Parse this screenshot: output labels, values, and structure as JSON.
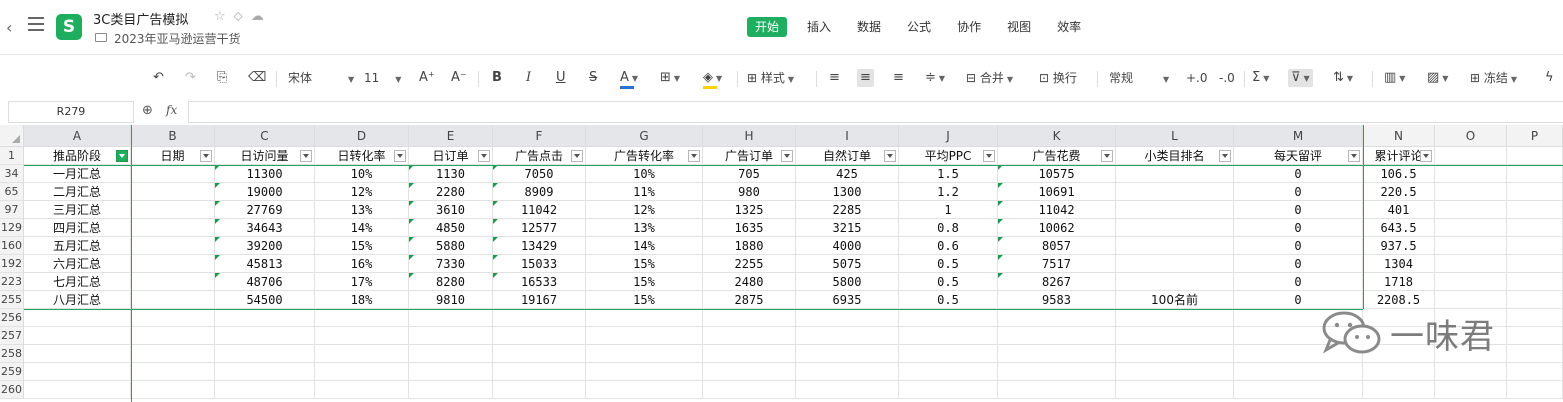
{
  "app": {
    "logo_letter": "S",
    "doc_title": "3C类目广告模拟",
    "doc_path": "2023年亚马逊运营干货"
  },
  "menu_tabs": [
    "开始",
    "插入",
    "数据",
    "公式",
    "协作",
    "视图",
    "效率"
  ],
  "active_tab": "开始",
  "toolbar": {
    "font_name": "宋体",
    "font_size": "11",
    "style_label": "样式",
    "merge_label": "合并",
    "wrap_label": "换行",
    "number_format": "常规",
    "freeze_label": "冻结"
  },
  "formula_bar": {
    "name_box": "R279",
    "fx": "fx",
    "formula": ""
  },
  "columns": [
    "A",
    "B",
    "C",
    "D",
    "E",
    "F",
    "G",
    "H",
    "I",
    "J",
    "K",
    "L",
    "M",
    "N",
    "O",
    "P"
  ],
  "selected_columns": [
    "A",
    "B",
    "C",
    "D",
    "E",
    "F",
    "G",
    "H",
    "I",
    "J",
    "K",
    "L",
    "M"
  ],
  "header_row": {
    "row_label": "1",
    "cells": [
      "推品阶段",
      "日期",
      "日访问量",
      "日转化率",
      "日订单",
      "广告点击",
      "广告转化率",
      "广告订单",
      "自然订单",
      "平均PPC",
      "广告花费",
      "小类目排名",
      "每天留评",
      "累计评论"
    ]
  },
  "rows": [
    {
      "row_label": "34",
      "cells": [
        "一月汇总",
        "",
        "11300",
        "10%",
        "1130",
        "7050",
        "10%",
        "705",
        "425",
        "1.5",
        "10575",
        "",
        "0",
        "106.5"
      ]
    },
    {
      "row_label": "65",
      "cells": [
        "二月汇总",
        "",
        "19000",
        "12%",
        "2280",
        "8909",
        "11%",
        "980",
        "1300",
        "1.2",
        "10691",
        "",
        "0",
        "220.5"
      ]
    },
    {
      "row_label": "97",
      "cells": [
        "三月汇总",
        "",
        "27769",
        "13%",
        "3610",
        "11042",
        "12%",
        "1325",
        "2285",
        "1",
        "11042",
        "",
        "0",
        "401"
      ]
    },
    {
      "row_label": "129",
      "cells": [
        "四月汇总",
        "",
        "34643",
        "14%",
        "4850",
        "12577",
        "13%",
        "1635",
        "3215",
        "0.8",
        "10062",
        "",
        "0",
        "643.5"
      ]
    },
    {
      "row_label": "160",
      "cells": [
        "五月汇总",
        "",
        "39200",
        "15%",
        "5880",
        "13429",
        "14%",
        "1880",
        "4000",
        "0.6",
        "8057",
        "",
        "0",
        "937.5"
      ]
    },
    {
      "row_label": "192",
      "cells": [
        "六月汇总",
        "",
        "45813",
        "16%",
        "7330",
        "15033",
        "15%",
        "2255",
        "5075",
        "0.5",
        "7517",
        "",
        "0",
        "1304"
      ]
    },
    {
      "row_label": "223",
      "cells": [
        "七月汇总",
        "",
        "48706",
        "17%",
        "8280",
        "16533",
        "15%",
        "2480",
        "5800",
        "0.5",
        "8267",
        "",
        "0",
        "1718"
      ]
    },
    {
      "row_label": "255",
      "cells": [
        "八月汇总",
        "",
        "54500",
        "18%",
        "9810",
        "19167",
        "15%",
        "2875",
        "6935",
        "0.5",
        "9583",
        "100名前",
        "0",
        "2208.5"
      ]
    }
  ],
  "empty_rows": [
    "256",
    "257",
    "258",
    "259",
    "260"
  ],
  "watermark": {
    "text": "一味君",
    "icon": "wechat-icon"
  }
}
